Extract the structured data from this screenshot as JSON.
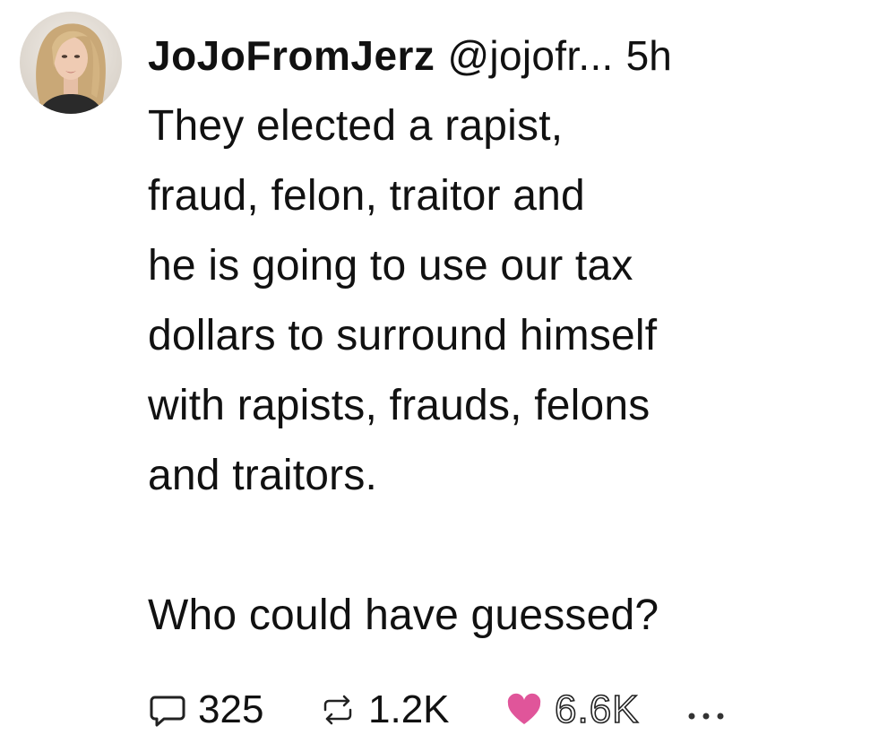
{
  "post": {
    "author": {
      "display_name": "JoJoFromJerz",
      "handle": "@jojofr...",
      "avatar_icon": "profile-photo"
    },
    "timestamp": "5h",
    "body": [
      "They elected a rapist,\nfraud, felon, traitor and\nhe is going to use our tax\ndollars to surround himself\nwith rapists, frauds, felons\nand traitors.",
      "Who could have guessed?"
    ],
    "actions": {
      "reply": {
        "icon": "reply-bubble-icon",
        "count": "325"
      },
      "repost": {
        "icon": "repost-arrows-icon",
        "count": "1.2K"
      },
      "like": {
        "icon": "heart-icon",
        "count": "6.6K",
        "color": "#e0559a"
      },
      "more": {
        "icon": "more-dots-icon"
      }
    }
  }
}
